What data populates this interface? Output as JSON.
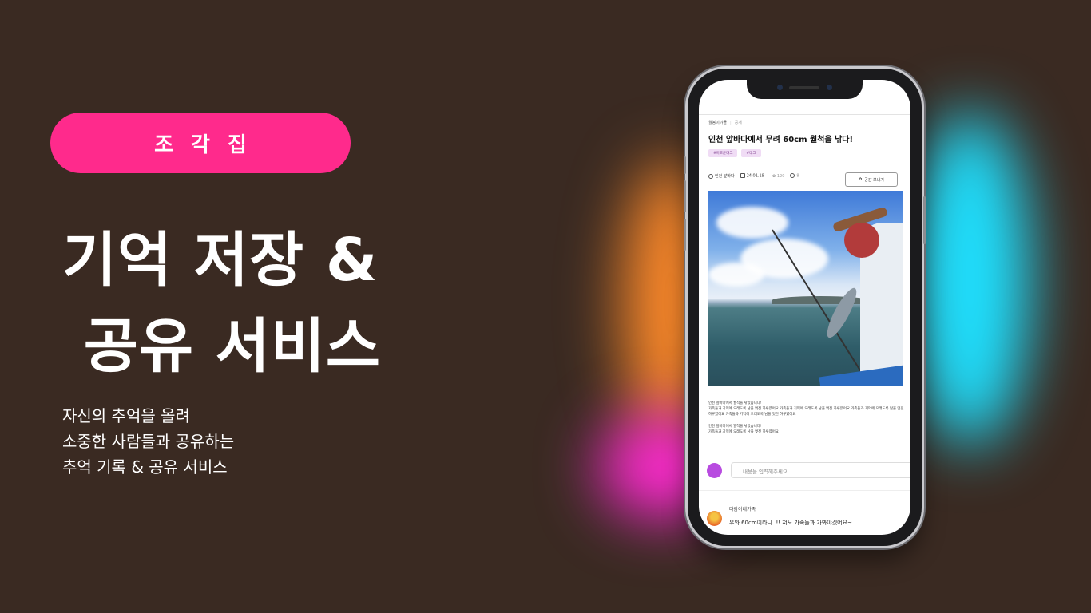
{
  "brand_pill": "조각집",
  "headline": [
    "기억 저장 &",
    " 공유 서비스"
  ],
  "description": [
    "자신의 추억을 올려",
    "소중한 사람들과 공유하는",
    "추억 기록 & 공유 서비스"
  ],
  "colors": {
    "background": "#3a2a22",
    "pill": "#ff2a8c",
    "tag_bg": "#f0dcf5"
  },
  "phone": {
    "breadcrumb": {
      "group": "월봉이야들",
      "visibility": "공개"
    },
    "post_title": "인천 앞바다에서 무려 60cm 월척을 낚다!",
    "tags": [
      "#아로운태그",
      "#태그"
    ],
    "meta": {
      "location": "인천 앞바다",
      "date": "24.01.19",
      "likes": "120",
      "comments": "8"
    },
    "send_button": "공감 보내기",
    "body": [
      "인천 앞바다에서 월척을 낚았습니다!",
      "가족들과 기억에 오래도록 남을 멋진 하루였어요 가족들과 기억에 오래도록 남을 멋진 하루였어요 가족들과 기억에 오래도록 남을 멋진 하루였어요 가족들과 기억에 오래도록 남을 멋진 하루였어요",
      "인천 앞바다에서 월척을 낚았습니다!",
      "가족들과 기억에 오래도록 남을 멋진 하루였어요"
    ],
    "comment_placeholder": "내용을 입력해주세요.",
    "comment": {
      "author": "다람이네가족",
      "text": "우와 60cm이라니..!! 저도 가족들과 가봐야겠어요~"
    }
  }
}
